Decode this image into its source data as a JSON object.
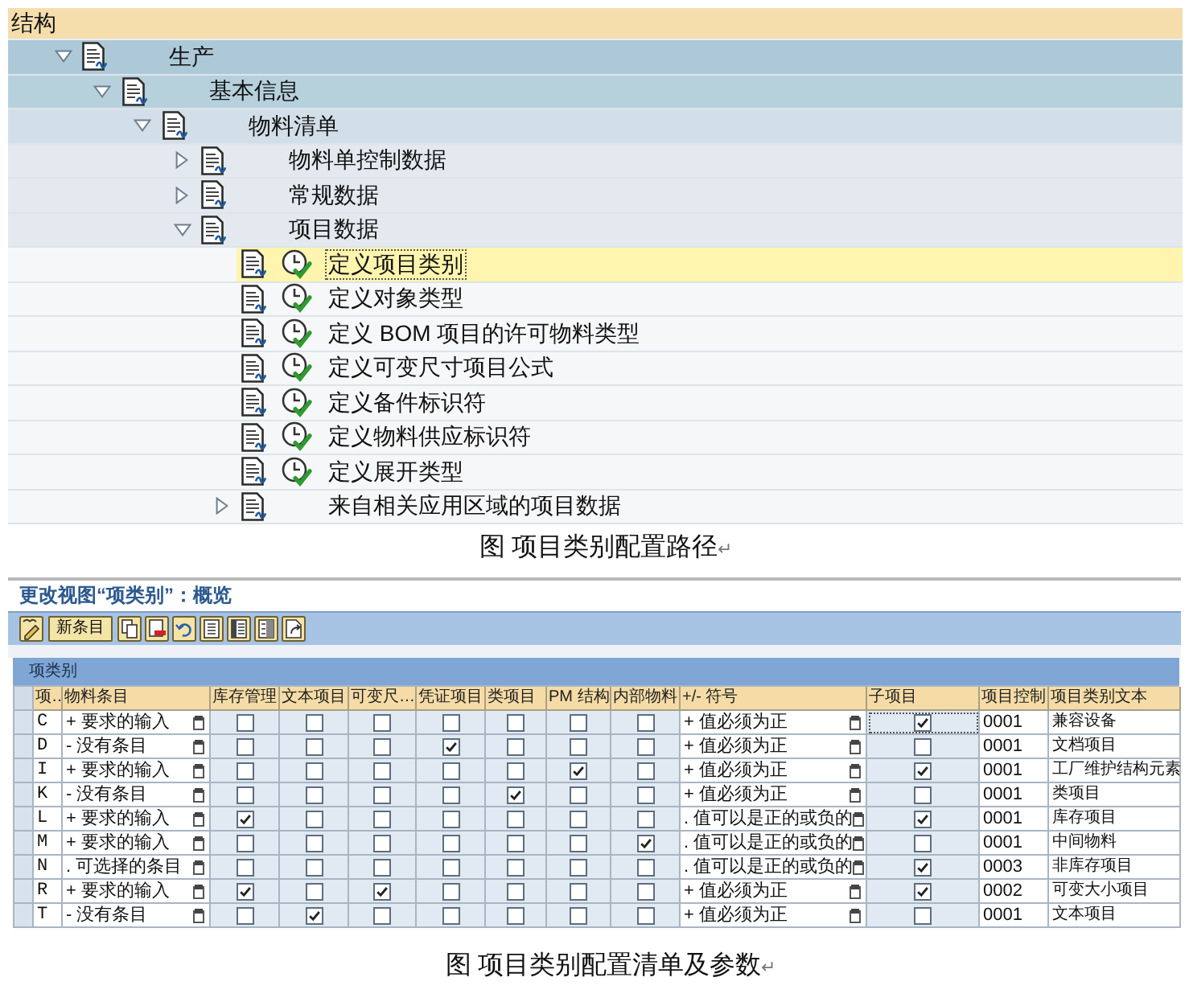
{
  "structure": {
    "title": "结构",
    "tree": [
      {
        "kind": "folder",
        "label": "生产",
        "expanded": true,
        "selected": false,
        "children": [
          {
            "kind": "folder",
            "label": "基本信息",
            "expanded": true,
            "selected": false,
            "children": [
              {
                "kind": "folder",
                "label": "物料清单",
                "expanded": true,
                "selected": false,
                "children": [
                  {
                    "kind": "folder",
                    "label": "物料单控制数据",
                    "expanded": false,
                    "selected": false
                  },
                  {
                    "kind": "folder",
                    "label": "常规数据",
                    "expanded": false,
                    "selected": false
                  },
                  {
                    "kind": "folder",
                    "label": "项目数据",
                    "expanded": true,
                    "selected": false,
                    "children": [
                      {
                        "kind": "activity",
                        "label": "定义项目类别",
                        "selected": true
                      },
                      {
                        "kind": "activity",
                        "label": "定义对象类型",
                        "selected": false
                      },
                      {
                        "kind": "activity",
                        "label": "定义 BOM 项目的许可物料类型",
                        "selected": false
                      },
                      {
                        "kind": "activity",
                        "label": "定义可变尺寸项目公式",
                        "selected": false
                      },
                      {
                        "kind": "activity",
                        "label": "定义备件标识符",
                        "selected": false
                      },
                      {
                        "kind": "activity",
                        "label": "定义物料供应标识符",
                        "selected": false
                      },
                      {
                        "kind": "activity",
                        "label": "定义展开类型",
                        "selected": false
                      },
                      {
                        "kind": "folder",
                        "label": "来自相关应用区域的项目数据",
                        "expanded": false,
                        "selected": false
                      }
                    ]
                  }
                ]
              }
            ]
          }
        ]
      }
    ]
  },
  "structure_caption": {
    "text": "图 项目类别配置路径",
    "mark": "↵"
  },
  "view": {
    "title": "更改视图“项类别”：概览",
    "toolbar": {
      "new_entry": "新条目"
    },
    "table": {
      "title": "项类别",
      "columns": [
        "项…",
        "物料条目",
        "库存管理",
        "文本项目",
        "可变尺…",
        "凭证项目",
        "类项目",
        "PM 结构",
        "内部物料",
        "+/- 符号",
        "子项目",
        "项目控制",
        "项目类别文本"
      ],
      "rows": [
        {
          "selected": false,
          "item_category": "C",
          "material_entry": "+ 要求的输入",
          "stock_management": false,
          "text_item": false,
          "variable_size": false,
          "document_item": false,
          "class_item": false,
          "pm_structure": false,
          "internal_material": false,
          "sign": "+ 值必须为正",
          "sub_item": true,
          "focused": true,
          "item_control": "0001",
          "text": "兼容设备"
        },
        {
          "selected": false,
          "item_category": "D",
          "material_entry": "- 没有条目",
          "stock_management": false,
          "text_item": false,
          "variable_size": false,
          "document_item": true,
          "class_item": false,
          "pm_structure": false,
          "internal_material": false,
          "sign": "+ 值必须为正",
          "sub_item": false,
          "focused": false,
          "item_control": "0001",
          "text": "文档项目"
        },
        {
          "selected": false,
          "item_category": "I",
          "material_entry": "+ 要求的输入",
          "stock_management": false,
          "text_item": false,
          "variable_size": false,
          "document_item": false,
          "class_item": false,
          "pm_structure": true,
          "internal_material": false,
          "sign": "+ 值必须为正",
          "sub_item": true,
          "focused": false,
          "item_control": "0001",
          "text": "工厂维护结构元素"
        },
        {
          "selected": false,
          "item_category": "K",
          "material_entry": "- 没有条目",
          "stock_management": false,
          "text_item": false,
          "variable_size": false,
          "document_item": false,
          "class_item": true,
          "pm_structure": false,
          "internal_material": false,
          "sign": "+ 值必须为正",
          "sub_item": false,
          "focused": false,
          "item_control": "0001",
          "text": "类项目"
        },
        {
          "selected": false,
          "item_category": "L",
          "material_entry": "+ 要求的输入",
          "stock_management": true,
          "text_item": false,
          "variable_size": false,
          "document_item": false,
          "class_item": false,
          "pm_structure": false,
          "internal_material": false,
          "sign": ". 值可以是正的或负的",
          "sub_item": true,
          "focused": false,
          "item_control": "0001",
          "text": "库存项目"
        },
        {
          "selected": false,
          "item_category": "M",
          "material_entry": "+ 要求的输入",
          "stock_management": false,
          "text_item": false,
          "variable_size": false,
          "document_item": false,
          "class_item": false,
          "pm_structure": false,
          "internal_material": true,
          "sign": ". 值可以是正的或负的",
          "sub_item": false,
          "focused": false,
          "item_control": "0001",
          "text": "中间物料"
        },
        {
          "selected": false,
          "item_category": "N",
          "material_entry": ". 可选择的条目",
          "stock_management": false,
          "text_item": false,
          "variable_size": false,
          "document_item": false,
          "class_item": false,
          "pm_structure": false,
          "internal_material": false,
          "sign": ". 值可以是正的或负的",
          "sub_item": true,
          "focused": false,
          "item_control": "0003",
          "text": "非库存项目"
        },
        {
          "selected": false,
          "item_category": "R",
          "material_entry": "+ 要求的输入",
          "stock_management": true,
          "text_item": false,
          "variable_size": true,
          "document_item": false,
          "class_item": false,
          "pm_structure": false,
          "internal_material": false,
          "sign": "+ 值必须为正",
          "sub_item": true,
          "focused": false,
          "item_control": "0002",
          "text": "可变大小项目"
        },
        {
          "selected": false,
          "item_category": "T",
          "material_entry": "- 没有条目",
          "stock_management": false,
          "text_item": true,
          "variable_size": false,
          "document_item": false,
          "class_item": false,
          "pm_structure": false,
          "internal_material": false,
          "sign": "+ 值必须为正",
          "sub_item": false,
          "focused": false,
          "item_control": "0001",
          "text": "文本项目"
        }
      ]
    }
  },
  "table_caption": {
    "text": "图 项目类别配置清单及参数",
    "mark": "↵"
  }
}
